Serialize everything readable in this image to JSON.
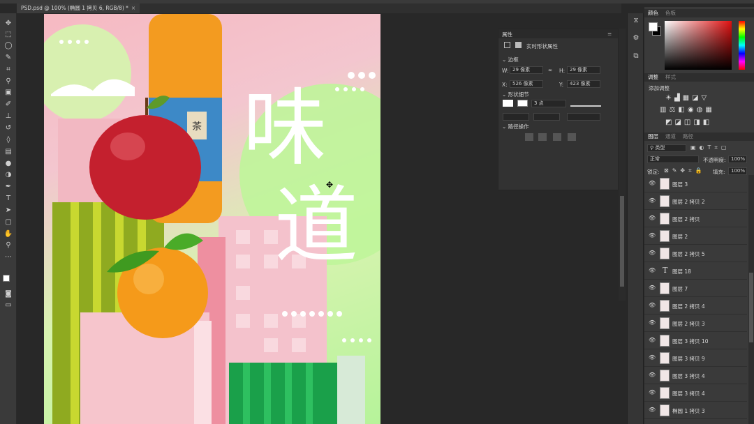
{
  "document": {
    "tab_title": "PSD.psd @ 100% (椭圆 1 拷贝 6, RGB/8) *",
    "tab_close": "×"
  },
  "toolbar": {
    "tools": [
      "move-icon",
      "marquee-icon",
      "lasso-icon",
      "quick-select-icon",
      "crop-icon",
      "eyedropper-icon",
      "healing-icon",
      "brush-icon",
      "stamp-icon",
      "history-brush-icon",
      "eraser-icon",
      "gradient-icon",
      "blur-icon",
      "dodge-icon",
      "pen-icon",
      "type-icon",
      "path-select-icon",
      "shape-icon",
      "hand-icon",
      "zoom-icon",
      "more-icon"
    ]
  },
  "properties": {
    "title": "属性",
    "subtitle": "实时形状属性",
    "section_transform": "边框",
    "w_label": "W:",
    "w_value": "29 像素",
    "h_label": "H:",
    "h_value": "29 像素",
    "x_label": "X:",
    "x_value": "526 像素",
    "y_label": "Y:",
    "y_value": "423 像素",
    "section_shape": "形状细节",
    "stroke_width": "3 点",
    "section_path": "路径操作"
  },
  "color_panel": {
    "tabs": [
      "颜色",
      "色板"
    ],
    "fg_color": "#ffffff",
    "bg_color": "#000000"
  },
  "adjust_panel": {
    "tabs": [
      "调整",
      "样式"
    ],
    "add_label": "添加调整"
  },
  "layers_panel": {
    "tabs": [
      "图层",
      "通道",
      "路径"
    ],
    "filter_label": "类型",
    "blend_mode": "正常",
    "opacity_label": "不透明度:",
    "opacity_value": "100%",
    "lock_label": "锁定:",
    "fill_label": "填充:",
    "fill_value": "100%",
    "layers": [
      {
        "name": "图层 3",
        "type": "pixel"
      },
      {
        "name": "图层 2 拷贝 2",
        "type": "pixel"
      },
      {
        "name": "图层 2 拷贝",
        "type": "pixel"
      },
      {
        "name": "图层 2",
        "type": "pixel"
      },
      {
        "name": "图层 2 拷贝 5",
        "type": "pixel"
      },
      {
        "name": "图层 18",
        "type": "text"
      },
      {
        "name": "图层 7",
        "type": "pixel"
      },
      {
        "name": "图层 2 拷贝 4",
        "type": "pixel"
      },
      {
        "name": "图层 2 拷贝 3",
        "type": "pixel"
      },
      {
        "name": "图层 3 拷贝 10",
        "type": "pixel"
      },
      {
        "name": "图层 3 拷贝 9",
        "type": "pixel"
      },
      {
        "name": "图层 3 拷贝 4",
        "type": "pixel"
      },
      {
        "name": "图层 3 拷贝 4",
        "type": "pixel"
      },
      {
        "name": "椭圆 1 拷贝 3",
        "type": "shape"
      }
    ]
  },
  "artwork": {
    "title_char_1": "味",
    "title_char_2": "道",
    "bottle_label": "茶"
  }
}
